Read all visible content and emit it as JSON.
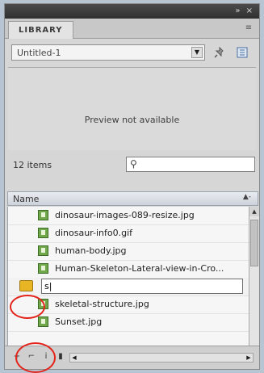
{
  "panel": {
    "tab_label": "LIBRARY",
    "window_controls": "»  ×",
    "menu_icon": "≡"
  },
  "document": {
    "selected": "Untitled-1"
  },
  "preview": {
    "message": "Preview not available"
  },
  "search": {
    "count": "12 items",
    "placeholder": "",
    "icon": "search-icon"
  },
  "list": {
    "column_name": "Name",
    "items": [
      {
        "name": "dinosaur-images-089-resize.jpg",
        "icon": "bitmap-icon"
      },
      {
        "name": "dinosaur-info0.gif",
        "icon": "bitmap-icon"
      },
      {
        "name": "human-body.jpg",
        "icon": "bitmap-icon"
      },
      {
        "name": "Human-Skeleton-Lateral-view-in-Cro...",
        "icon": "bitmap-icon"
      },
      {
        "name": "skeletal-structure.jpg",
        "icon": "bitmap-icon"
      },
      {
        "name": "Sunset.jpg",
        "icon": "bitmap-icon"
      }
    ],
    "editing_value": "s|"
  },
  "colors": {
    "annotation": "#e3241b",
    "panel_bg": "#d6d6d6"
  }
}
